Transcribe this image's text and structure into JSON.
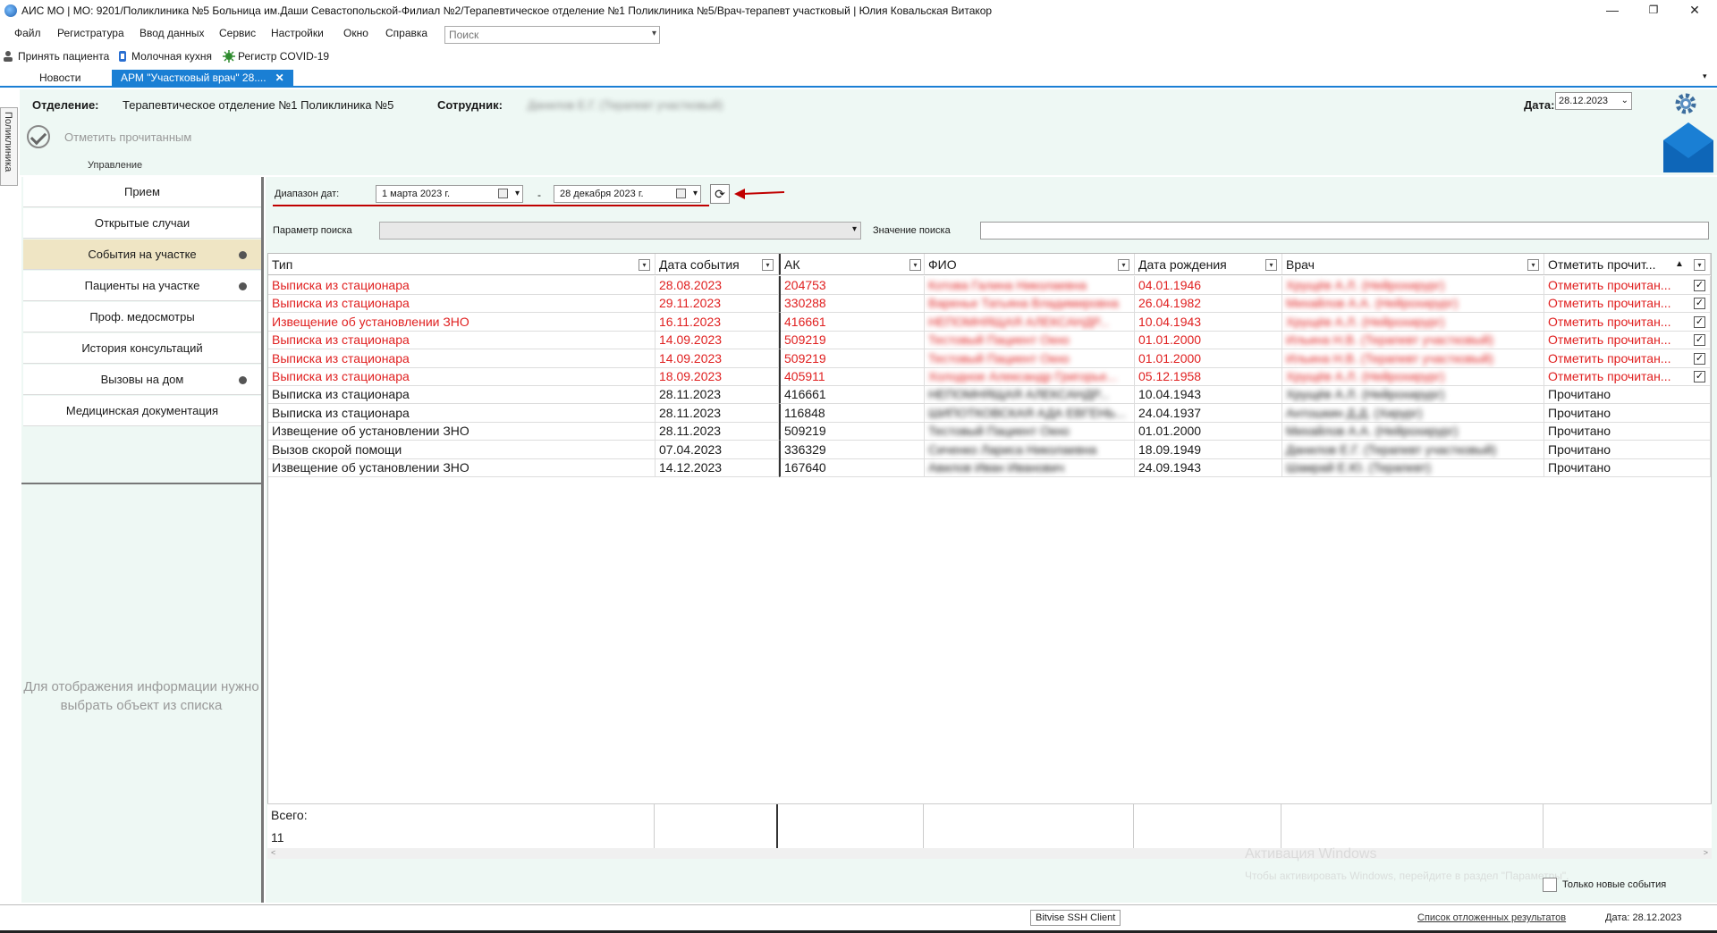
{
  "window": {
    "title": "АИС МО | МО: 9201/Поликлиника №5 Больница им.Даши Севастопольской-Филиал №2/Терапевтическое отделение №1 Поликлиника №5/Врач-терапевт участковый | Юлия Ковальская Витакор",
    "min": "—",
    "max": "❐",
    "close": "✕"
  },
  "menu": [
    "Файл",
    "Регистратура",
    "Ввод данных",
    "Сервис",
    "Настройки",
    "Окно",
    "Справка"
  ],
  "search": {
    "placeholder": "Поиск"
  },
  "toolbar": {
    "accept": "Принять пациента",
    "milk": "Молочная кухня",
    "covid": "Регистр COVID-19"
  },
  "tabs": {
    "news": "Новости",
    "arm": "АРМ \"Участковый врач\" 28....",
    "close": "✕"
  },
  "side_strip": "Поликлиника",
  "header": {
    "dept_label": "Отделение:",
    "dept_value": "Терапевтическое отделение №1 Поликлиника №5",
    "employee_label": "Сотрудник:",
    "employee_value": "Данилов Е.Г. (Терапевт участковый)",
    "date_label": "Дата:",
    "date_value": "28.12.2023",
    "mark_read": "Отметить прочитанным",
    "manage": "Управление"
  },
  "nav": [
    {
      "label": "Прием",
      "dot": false
    },
    {
      "label": "Открытые случаи",
      "dot": false
    },
    {
      "label": "События на участке",
      "dot": true,
      "active": true
    },
    {
      "label": "Пациенты на участке",
      "dot": true
    },
    {
      "label": "Проф. медосмотры",
      "dot": false
    },
    {
      "label": "История консультаций",
      "dot": false
    },
    {
      "label": "Вызовы на дом",
      "dot": true
    },
    {
      "label": "Медицинская документация",
      "dot": false
    }
  ],
  "nav_info": "Для отображения информации нужно выбрать объект из списка",
  "filters": {
    "range_label": "Диапазон дат:",
    "date_from": "1   марта   2023 г.",
    "dash": "-",
    "date_to": "28  декабря  2023 г.",
    "param_label": "Параметр поиска",
    "value_label": "Значение поиска"
  },
  "grid": {
    "columns": [
      "Тип",
      "Дата события",
      "АК",
      "ФИО",
      "Дата рождения",
      "Врач",
      "Отметить прочит..."
    ],
    "rows": [
      {
        "type": "Выписка из стационара",
        "date": "28.08.2023",
        "ak": "204753",
        "fio": "Котова Галина Николаевна",
        "birth": "04.01.1946",
        "doctor": "Хрущёв А.Л. (Нейрохирург)",
        "mark": "Отметить прочитан...",
        "unread": true
      },
      {
        "type": "Выписка из стационара",
        "date": "29.11.2023",
        "ak": "330288",
        "fio": "Варенье Татьяна Владимировна",
        "birth": "26.04.1982",
        "doctor": "Михайлов А.А. (Нейрохирург)",
        "mark": "Отметить прочитан...",
        "unread": true
      },
      {
        "type": "Извещение об установлении ЗНО",
        "date": "16.11.2023",
        "ak": "416661",
        "fio": "НЕПОМНЯЩАЯ АЛЕКСАНДР...",
        "birth": "10.04.1943",
        "doctor": "Хрущёв А.Л. (Нейрохирург)",
        "mark": "Отметить прочитан...",
        "unread": true
      },
      {
        "type": "Выписка из стационара",
        "date": "14.09.2023",
        "ak": "509219",
        "fio": "Тестовый Пациент Окно",
        "birth": "01.01.2000",
        "doctor": "Ильина Н.В. (Терапевт участковый)",
        "mark": "Отметить прочитан...",
        "unread": true
      },
      {
        "type": "Выписка из стационара",
        "date": "14.09.2023",
        "ak": "509219",
        "fio": "Тестовый Пациент Окно",
        "birth": "01.01.2000",
        "doctor": "Ильина Н.В. (Терапевт участковый)",
        "mark": "Отметить прочитан...",
        "unread": true
      },
      {
        "type": "Выписка из стационара",
        "date": "18.09.2023",
        "ak": "405911",
        "fio": "Холодное Александр Григорье...",
        "birth": "05.12.1958",
        "doctor": "Хрущёв А.Л. (Нейрохирург)",
        "mark": "Отметить прочитан...",
        "unread": true
      },
      {
        "type": "Выписка из стационара",
        "date": "28.11.2023",
        "ak": "416661",
        "fio": "НЕПОМНЯЩАЯ АЛЕКСАНДР...",
        "birth": "10.04.1943",
        "doctor": "Хрущёв А.Л. (Нейрохирург)",
        "mark": "Прочитано",
        "unread": false
      },
      {
        "type": "Выписка из стационара",
        "date": "28.11.2023",
        "ak": "116848",
        "fio": "ШИПОТКОВСКАЯ АДА ЕВГЕНЬ...",
        "birth": "24.04.1937",
        "doctor": "Антошкин Д.Д. (Хирург)",
        "mark": "Прочитано",
        "unread": false
      },
      {
        "type": "Извещение об установлении ЗНО",
        "date": "28.11.2023",
        "ak": "509219",
        "fio": "Тестовый Пациент Окно",
        "birth": "01.01.2000",
        "doctor": "Михайлов А.А. (Нейрохирург)",
        "mark": "Прочитано",
        "unread": false
      },
      {
        "type": "Вызов скорой помощи",
        "date": "07.04.2023",
        "ak": "336329",
        "fio": "Сиченко Лариса Николаевна",
        "birth": "18.09.1949",
        "doctor": "Данилов Е.Г. (Терапевт участковый)",
        "mark": "Прочитано",
        "unread": false
      },
      {
        "type": "Извещение об установлении ЗНО",
        "date": "14.12.2023",
        "ak": "167640",
        "fio": "Авилов Иван Иванович",
        "birth": "24.09.1943",
        "doctor": "Шамрай Е.Ю. (Терапевт)",
        "mark": "Прочитано",
        "unread": false
      }
    ],
    "total_label": "Всего:",
    "total_value": "11"
  },
  "only_new": "Только новые события",
  "activation": {
    "line1": "Активация Windows",
    "line2": "Чтобы активировать Windows, перейдите в раздел \"Параметры\"."
  },
  "status": {
    "ssh": "Bitvise SSH Client",
    "deferred": "Список отложенных результатов",
    "date": "Дата: 28.12.2023"
  },
  "colors": {
    "accent": "#1a7fd4",
    "unread": "#e02020",
    "panel": "#eef8f4",
    "active_nav": "#efe5c4"
  }
}
